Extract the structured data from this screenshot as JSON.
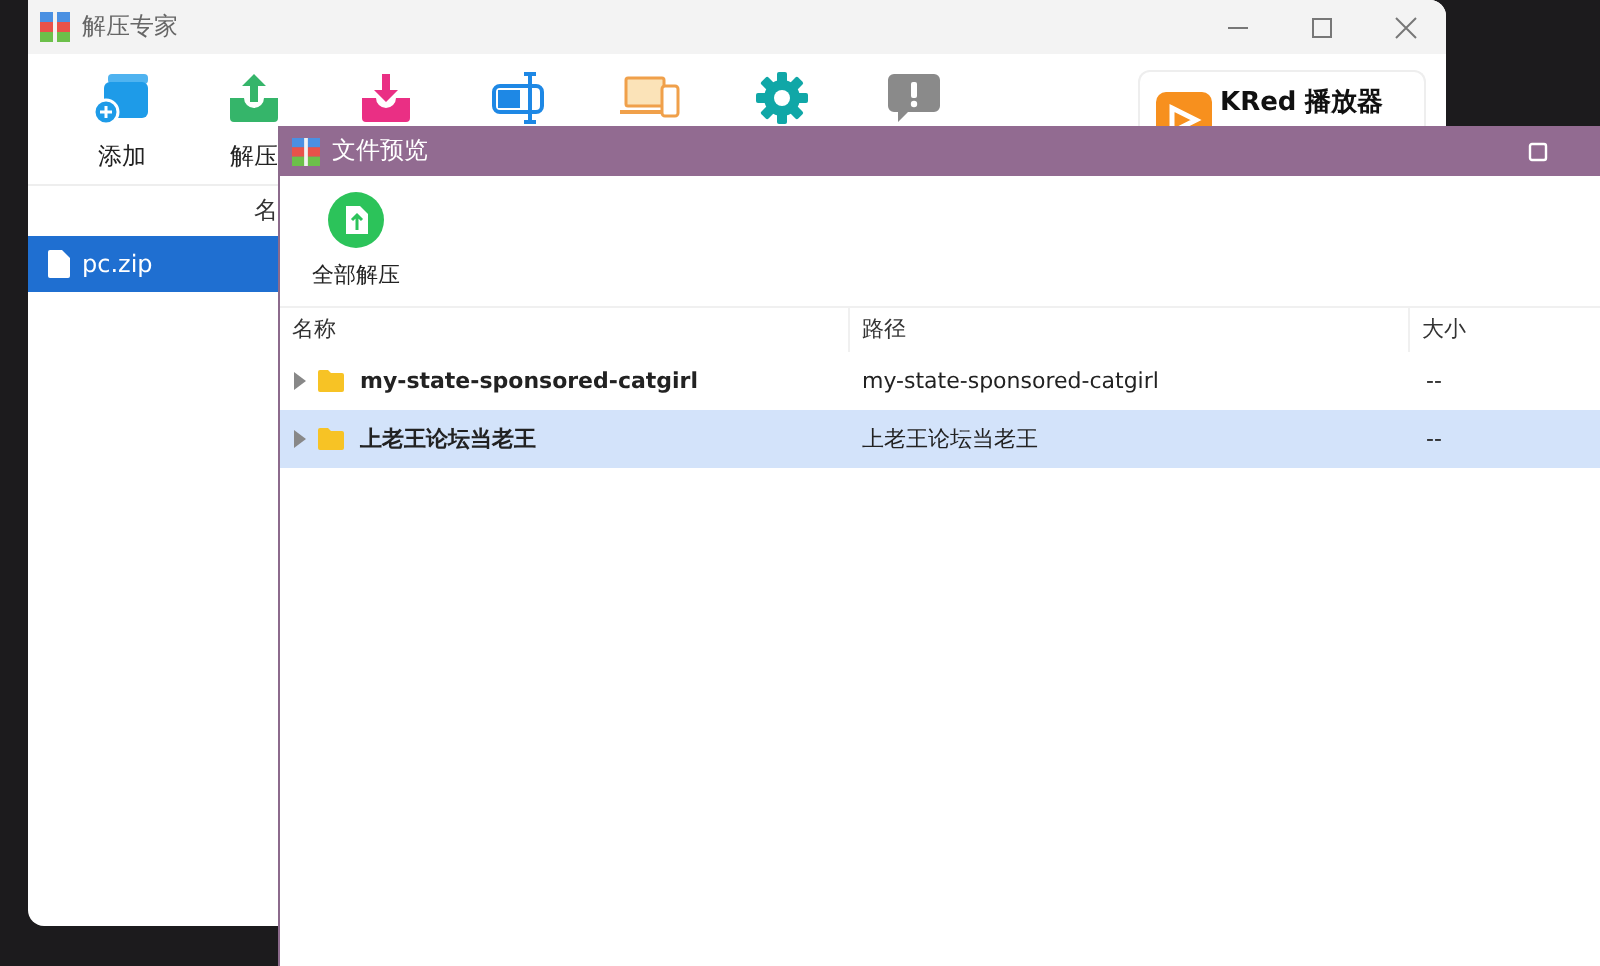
{
  "main_window": {
    "title": "解压专家",
    "toolbar": [
      {
        "kind": "add",
        "label": "添加"
      },
      {
        "kind": "extract",
        "label": "解压"
      },
      {
        "kind": "import"
      },
      {
        "kind": "split"
      },
      {
        "kind": "devices"
      },
      {
        "kind": "settings"
      },
      {
        "kind": "feedback"
      }
    ],
    "ad": {
      "title": "KRed 播放器"
    },
    "list_header": "名",
    "files": [
      {
        "name": "pc.zip",
        "selected": true
      }
    ]
  },
  "preview_window": {
    "title": "文件预览",
    "toolbar": [
      {
        "label": "全部解压"
      }
    ],
    "columns": [
      "名称",
      "路径",
      "大小"
    ],
    "rows": [
      {
        "name": "my-state-sponsored-catgirl",
        "path": "my-state-sponsored-catgirl",
        "size": "--",
        "selected": false
      },
      {
        "name": "上老王论坛当老王",
        "path": "上老王论坛当老王",
        "size": "--",
        "selected": true
      }
    ]
  }
}
